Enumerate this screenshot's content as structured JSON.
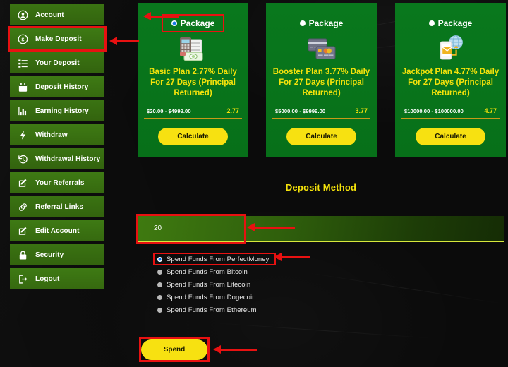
{
  "sidebar": {
    "items": [
      {
        "label": "Account",
        "icon": "user-circle-icon",
        "highlighted": false
      },
      {
        "label": "Make Deposit",
        "icon": "coin-dollar-icon",
        "highlighted": true
      },
      {
        "label": "Your Deposit",
        "icon": "list-check-icon",
        "highlighted": false
      },
      {
        "label": "Deposit History",
        "icon": "calendar-icon",
        "highlighted": false
      },
      {
        "label": "Earning History",
        "icon": "bar-chart-icon",
        "highlighted": false
      },
      {
        "label": "Withdraw",
        "icon": "lightning-bolt-icon",
        "highlighted": false
      },
      {
        "label": "Withdrawal History",
        "icon": "clock-rewind-icon",
        "highlighted": false
      },
      {
        "label": "Your Referrals",
        "icon": "edit-square-icon",
        "highlighted": false
      },
      {
        "label": "Referral Links",
        "icon": "link-chain-icon",
        "highlighted": false
      },
      {
        "label": "Edit Account",
        "icon": "edit-square-icon",
        "highlighted": false
      },
      {
        "label": "Security",
        "icon": "lock-icon",
        "highlighted": false
      },
      {
        "label": "Logout",
        "icon": "logout-arrow-icon",
        "highlighted": false
      }
    ]
  },
  "packages": [
    {
      "package_label": "Package",
      "selected": true,
      "highlighted": true,
      "icon": "calculator-money-icon",
      "title": "Basic Plan 2.77% Daily For 27 Days (Principal Returned)",
      "price_range": "$20.00 - $4999.00",
      "rate": "2.77",
      "button_label": "Calculate"
    },
    {
      "package_label": "Package",
      "selected": false,
      "highlighted": false,
      "icon": "credit-cards-icon",
      "title": "Booster Plan 3.77% Daily For 27 Days (Principal Returned)",
      "price_range": "$5000.00 - $9999.00",
      "rate": "3.77",
      "button_label": "Calculate"
    },
    {
      "package_label": "Package",
      "selected": false,
      "highlighted": false,
      "icon": "mobile-globe-payment-icon",
      "title": "Jackpot Plan 4.77% Daily For 27 Days (Principal Returned)",
      "price_range": "$10000.00 - $100000.00",
      "rate": "4.77",
      "button_label": "Calculate"
    }
  ],
  "deposit": {
    "heading": "Deposit Method",
    "amount_value": "20",
    "amount_placeholder": "",
    "methods": [
      {
        "label": "Spend Funds From PerfectMoney",
        "selected": true,
        "highlighted": true
      },
      {
        "label": "Spend Funds From Bitcoin",
        "selected": false,
        "highlighted": false
      },
      {
        "label": "Spend Funds From Litecoin",
        "selected": false,
        "highlighted": false
      },
      {
        "label": "Spend Funds From Dogecoin",
        "selected": false,
        "highlighted": false
      },
      {
        "label": "Spend Funds From Ethereum",
        "selected": false,
        "highlighted": false
      }
    ],
    "spend_label": "Spend"
  },
  "colors": {
    "accent_yellow": "#f4e20b",
    "card_green": "#09781d",
    "sidebar_green": "#3a7312",
    "highlight_red": "#e81111",
    "radio_blue": "#1478e8",
    "background": "#0b0b0b"
  }
}
